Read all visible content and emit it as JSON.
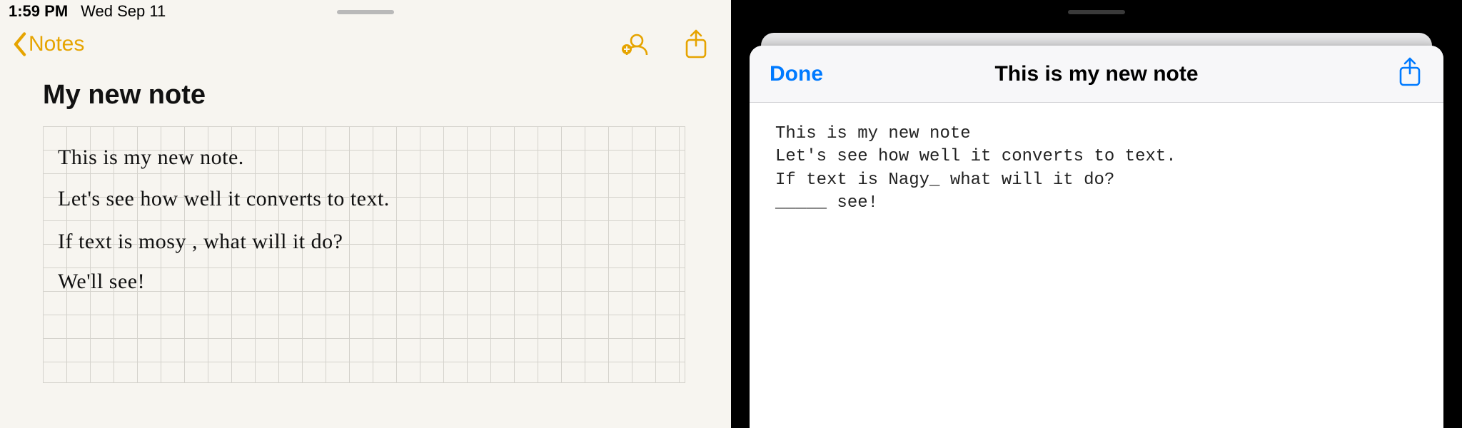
{
  "statusbar": {
    "time": "1:59 PM",
    "date": "Wed Sep 11"
  },
  "navbar": {
    "back_label": "Notes"
  },
  "note": {
    "title": "My new note",
    "handwriting": {
      "line1": "This is my new note.",
      "line2": "Let's see how well it converts to text.",
      "line3": "If text is mosy , what will it do?",
      "line4": "We'll see!"
    }
  },
  "sheet": {
    "done_label": "Done",
    "title": "This is my new note",
    "body": "This is my new note\nLet's see how well it converts to text.\nIf text is Nagy_ what will it do?\n_____ see!"
  }
}
